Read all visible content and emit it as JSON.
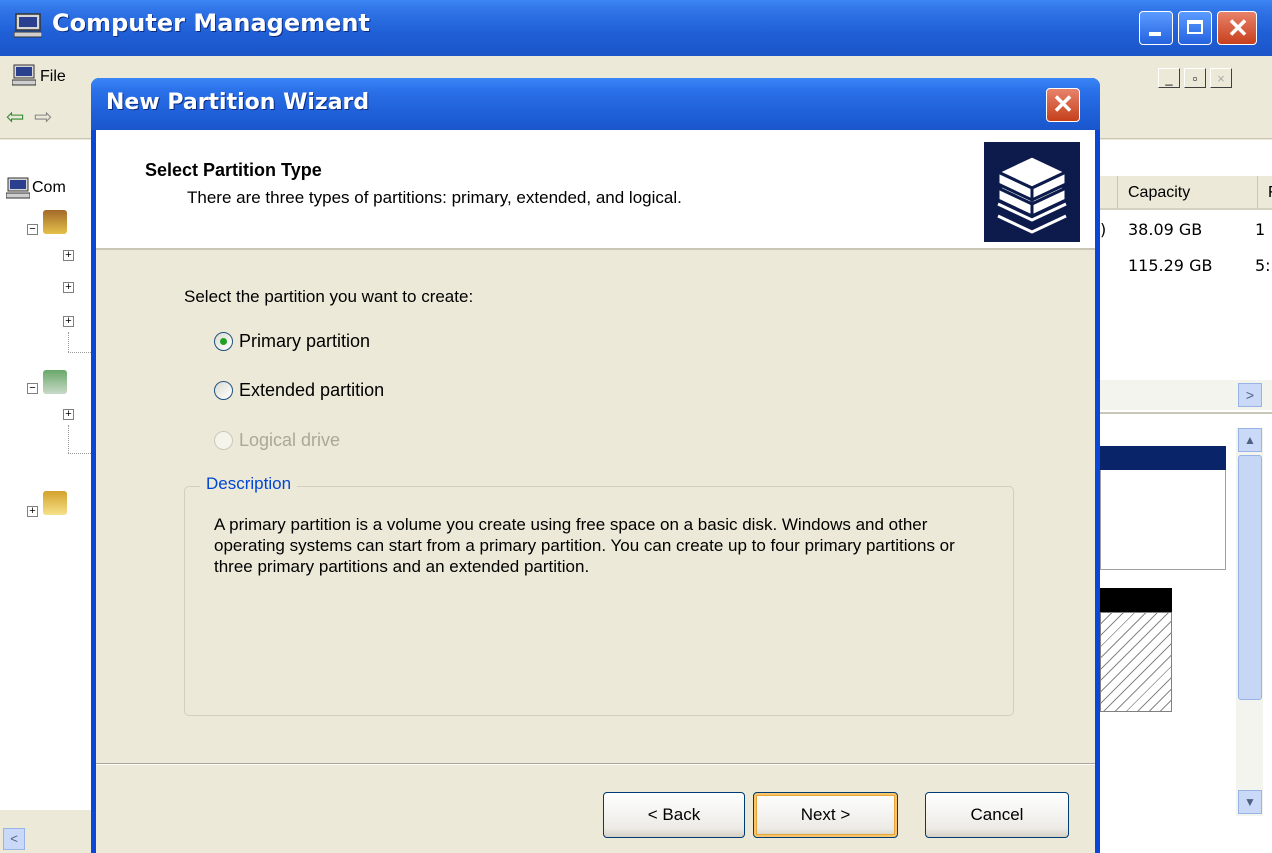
{
  "outer_window": {
    "title": "Computer Management",
    "menu_file": "File",
    "mdi_min": "_",
    "mdi_restore": "▫",
    "mdi_close": "×"
  },
  "tree": {
    "root_label": "Com"
  },
  "list": {
    "columns": [
      "Capacity",
      "Fr"
    ],
    "rows": [
      {
        "prefix": ")",
        "capacity": "38.09 GB",
        "free": "1"
      },
      {
        "prefix": "",
        "capacity": "115.29 GB",
        "free": "5:"
      }
    ]
  },
  "wizard": {
    "title": "New Partition Wizard",
    "close_glyph": "✕",
    "header_title": "Select Partition Type",
    "header_subtitle": "There are three types of partitions: primary, extended, and logical.",
    "prompt": "Select the partition you want to create:",
    "options": [
      {
        "label": "Primary partition",
        "selected": true,
        "enabled": true
      },
      {
        "label": "Extended partition",
        "selected": false,
        "enabled": true
      },
      {
        "label": "Logical drive",
        "selected": false,
        "enabled": false
      }
    ],
    "description_legend": "Description",
    "description_text": "A primary partition is a volume you create using free space on a basic disk. Windows and other operating systems can start from a primary partition. You can create up to four primary partitions or three primary partitions and an extended partition.",
    "buttons": {
      "back": "< Back",
      "next": "Next >",
      "cancel": "Cancel"
    }
  },
  "icons": {
    "title_icon": "computer-icon",
    "wizard_header_icon": "disk-stack-icon"
  },
  "colors": {
    "titlebar_blue": "#1f5fd6",
    "close_red": "#c7401d",
    "dialog_bg": "#ece9d8",
    "legend_blue": "#0046d5"
  }
}
